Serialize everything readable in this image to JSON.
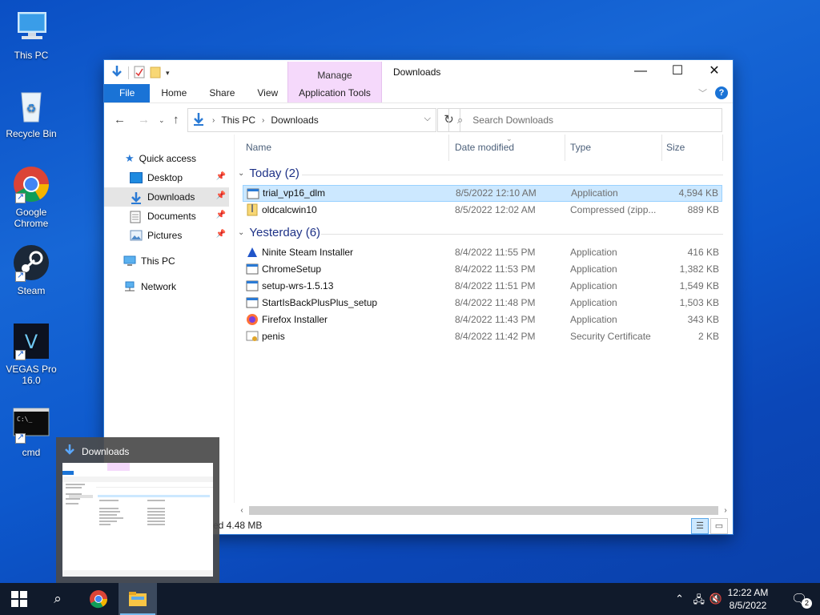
{
  "desktop": {
    "icons": [
      {
        "label": "This PC"
      },
      {
        "label": "Recycle Bin"
      },
      {
        "label": "Google Chrome"
      },
      {
        "label": "Steam"
      },
      {
        "label": "VEGAS Pro 16.0"
      },
      {
        "label": "cmd"
      }
    ]
  },
  "window": {
    "title": "Downloads",
    "manage_label": "Manage",
    "tabs": {
      "file": "File",
      "home": "Home",
      "share": "Share",
      "view": "View",
      "app_tools": "Application Tools"
    },
    "address": {
      "crumb1": "This PC",
      "crumb2": "Downloads"
    },
    "search_placeholder": "Search Downloads",
    "nav": {
      "quick_access": "Quick access",
      "desktop": "Desktop",
      "downloads": "Downloads",
      "documents": "Documents",
      "pictures": "Pictures",
      "this_pc": "This PC",
      "network": "Network"
    },
    "columns": {
      "name": "Name",
      "date": "Date modified",
      "type": "Type",
      "size": "Size"
    },
    "groups": {
      "today": "Today (2)",
      "yesterday": "Yesterday (6)"
    },
    "today_files": [
      {
        "name": "trial_vp16_dlm",
        "date": "8/5/2022 12:10 AM",
        "type": "Application",
        "size": "4,594 KB"
      },
      {
        "name": "oldcalcwin10",
        "date": "8/5/2022 12:02 AM",
        "type": "Compressed (zipp...",
        "size": "889 KB"
      }
    ],
    "yesterday_files": [
      {
        "name": "Ninite Steam Installer",
        "date": "8/4/2022 11:55 PM",
        "type": "Application",
        "size": "416 KB"
      },
      {
        "name": "ChromeSetup",
        "date": "8/4/2022 11:53 PM",
        "type": "Application",
        "size": "1,382 KB"
      },
      {
        "name": "setup-wrs-1.5.13",
        "date": "8/4/2022 11:51 PM",
        "type": "Application",
        "size": "1,549 KB"
      },
      {
        "name": "StartIsBackPlusPlus_setup",
        "date": "8/4/2022 11:48 PM",
        "type": "Application",
        "size": "1,503 KB"
      },
      {
        "name": "Firefox Installer",
        "date": "8/4/2022 11:43 PM",
        "type": "Application",
        "size": "343 KB"
      },
      {
        "name": "penis",
        "date": "8/4/2022 11:42 PM",
        "type": "Security Certificate",
        "size": "2 KB"
      }
    ],
    "status_text": "ed  4.48 MB"
  },
  "thumbnail": {
    "title": "Downloads"
  },
  "taskbar": {
    "clock_time": "12:22 AM",
    "clock_date": "8/5/2022",
    "notification_count": "2"
  },
  "colors": {
    "accent": "#1a73d6",
    "selection": "#cce8ff",
    "manage_tab": "#f5d9fb",
    "taskbar": "#101a2b"
  }
}
